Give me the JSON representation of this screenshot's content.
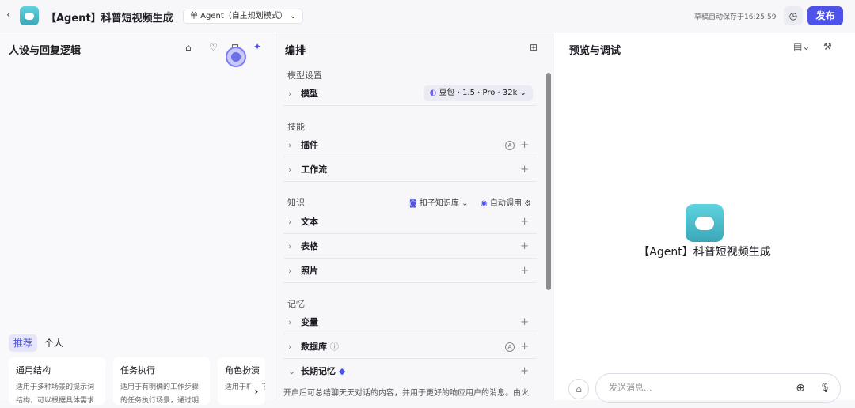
{
  "header": {
    "title": "【Agent】科普短视频生成",
    "mode": "单 Agent（自主规划模式）",
    "autosave": "草稿自动保存于16:25:59",
    "publish": "发布"
  },
  "left": {
    "title": "人设与回复逻辑",
    "tabs": [
      "推荐",
      "个人"
    ],
    "cards": [
      {
        "title": "通用结构",
        "desc": "适用于多种场景的提示词结构，可以根据具体需求"
      },
      {
        "title": "任务执行",
        "desc": "适用于有明确的工作步骤的任务执行场景，通过明"
      },
      {
        "title": "角色扮演",
        "desc": "适用于聊天陪伴、互动娱乐场景，"
      }
    ]
  },
  "mid": {
    "title": "编排",
    "model_section": "模型设置",
    "model_label": "模型",
    "model_value": "豆包 · 1.5 · Pro · 32k",
    "skills_section": "技能",
    "plugin": "插件",
    "workflow": "工作流",
    "knowledge_section": "知识",
    "kb_source": "扣子知识库",
    "kb_mode": "自动调用",
    "text": "文本",
    "table": "表格",
    "photo": "照片",
    "memory_section": "记忆",
    "variable": "变量",
    "database": "数据库",
    "long_memory": "长期记忆",
    "long_memory_desc": "开启后可总结聊天天对话的内容，并用于更好的响应用户的消息。由火"
  },
  "right": {
    "title": "预览与调试",
    "agent_name": "【Agent】科普短视频生成",
    "input_placeholder": "发送消息..."
  }
}
